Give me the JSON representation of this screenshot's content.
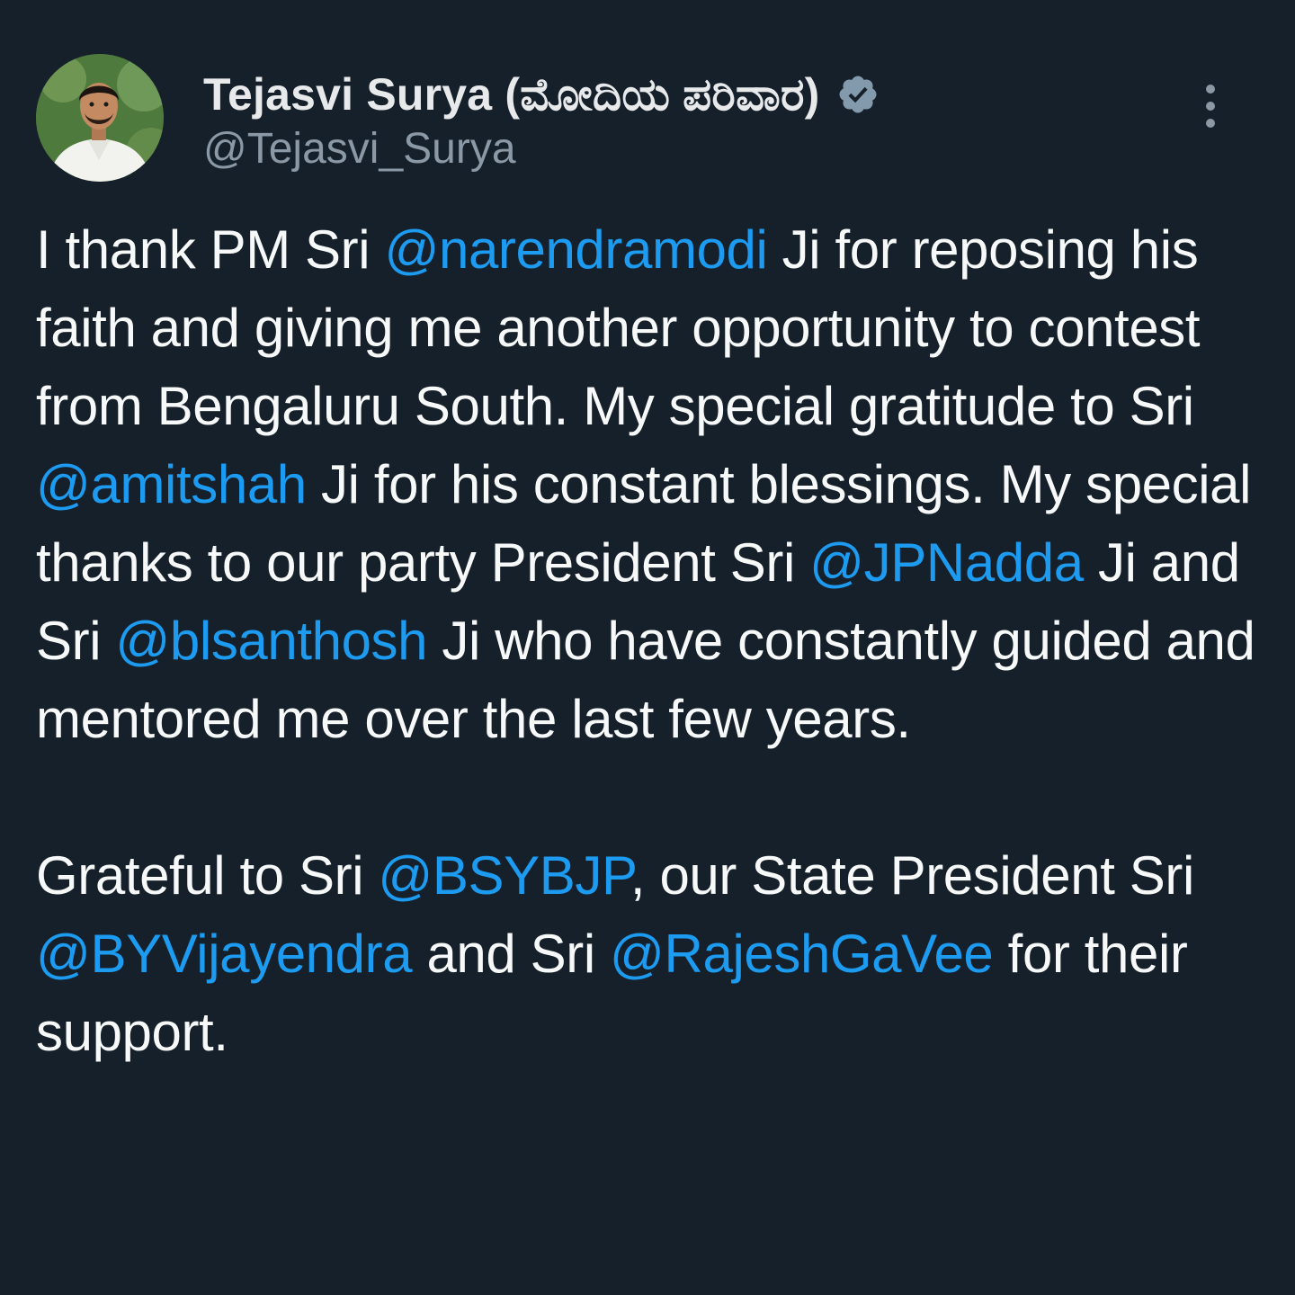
{
  "author": {
    "display_name": "Tejasvi Surya (ಮೋದಿಯ ಪರಿವಾರ)",
    "handle": "@Tejasvi_Surya",
    "verified": true,
    "avatar_icon": "profile-photo"
  },
  "colors": {
    "background": "#15202b",
    "text": "#f7f9f9",
    "secondary_text": "#8b98a5",
    "mention": "#1d9bf0",
    "verified_badge": "#829aab"
  },
  "menu": {
    "icon": "more-vertical-icon"
  },
  "tweet": {
    "paragraph1": [
      {
        "text": "I thank PM Sri "
      },
      {
        "text": "@narendramodi",
        "mention": true
      },
      {
        "text": " Ji for reposing his faith and giving me another opportunity to contest from Bengaluru South. My special gratitude to Sri "
      },
      {
        "text": "@amitshah",
        "mention": true
      },
      {
        "text": " Ji for his constant blessings. My special thanks to our party President Sri "
      },
      {
        "text": "@JPNadda",
        "mention": true
      },
      {
        "text": " Ji and Sri "
      },
      {
        "text": "@blsanthosh",
        "mention": true
      },
      {
        "text": " Ji who have constantly guided and mentored me over the last few years."
      }
    ],
    "paragraph2": [
      {
        "text": "Grateful to Sri "
      },
      {
        "text": "@BSYBJP",
        "mention": true
      },
      {
        "text": ", our State President Sri "
      },
      {
        "text": "@BYVijayendra",
        "mention": true
      },
      {
        "text": " and Sri "
      },
      {
        "text": "@RajeshGaVee",
        "mention": true
      },
      {
        "text": " for their support."
      }
    ]
  }
}
